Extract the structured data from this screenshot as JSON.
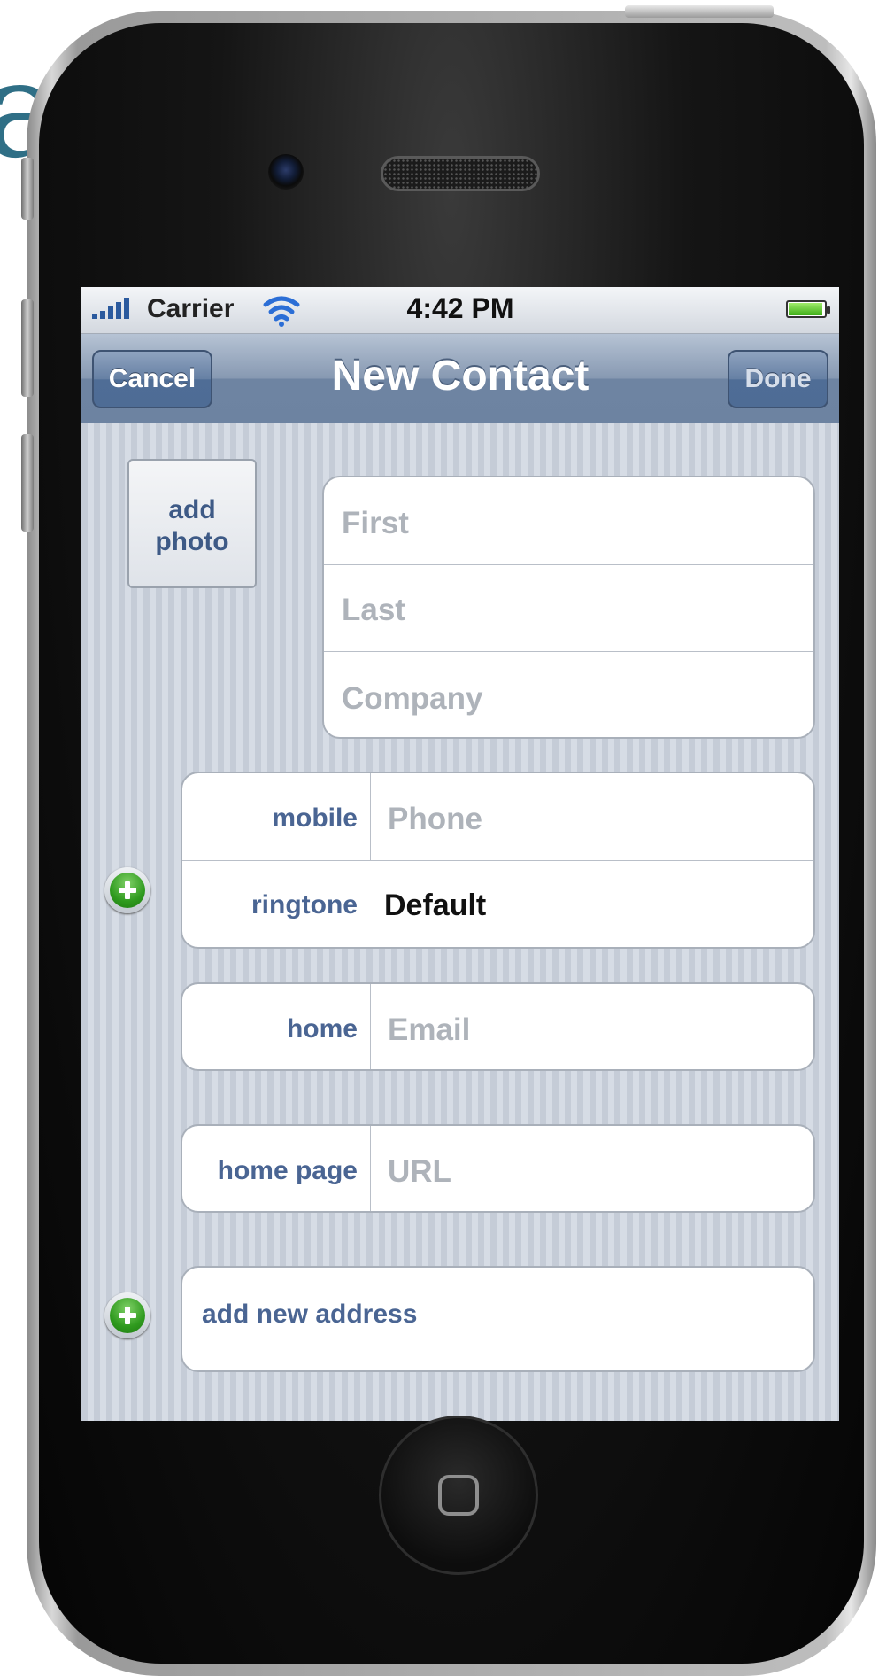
{
  "background_fragment": "at",
  "status_bar": {
    "carrier": "Carrier",
    "time": "4:42 PM"
  },
  "nav": {
    "title": "New Contact",
    "cancel_label": "Cancel",
    "done_label": "Done"
  },
  "photo": {
    "line1": "add",
    "line2": "photo"
  },
  "name_fields": {
    "first_placeholder": "First",
    "last_placeholder": "Last",
    "company_placeholder": "Company"
  },
  "phone_group": {
    "phone_label": "mobile",
    "phone_placeholder": "Phone",
    "ringtone_label": "ringtone",
    "ringtone_value": "Default"
  },
  "email_group": {
    "label": "home",
    "placeholder": "Email"
  },
  "url_group": {
    "label": "home page",
    "placeholder": "URL"
  },
  "address": {
    "label": "add new address"
  },
  "icons": {
    "signal": "signal-bars-icon",
    "wifi": "wifi-icon",
    "battery": "battery-icon",
    "add": "add-field-icon"
  },
  "colors": {
    "nav_bar": "#6d83a1",
    "label_blue": "#4a6593",
    "placeholder_gray": "#aeb3ba",
    "add_green": "#2f9a1e"
  }
}
